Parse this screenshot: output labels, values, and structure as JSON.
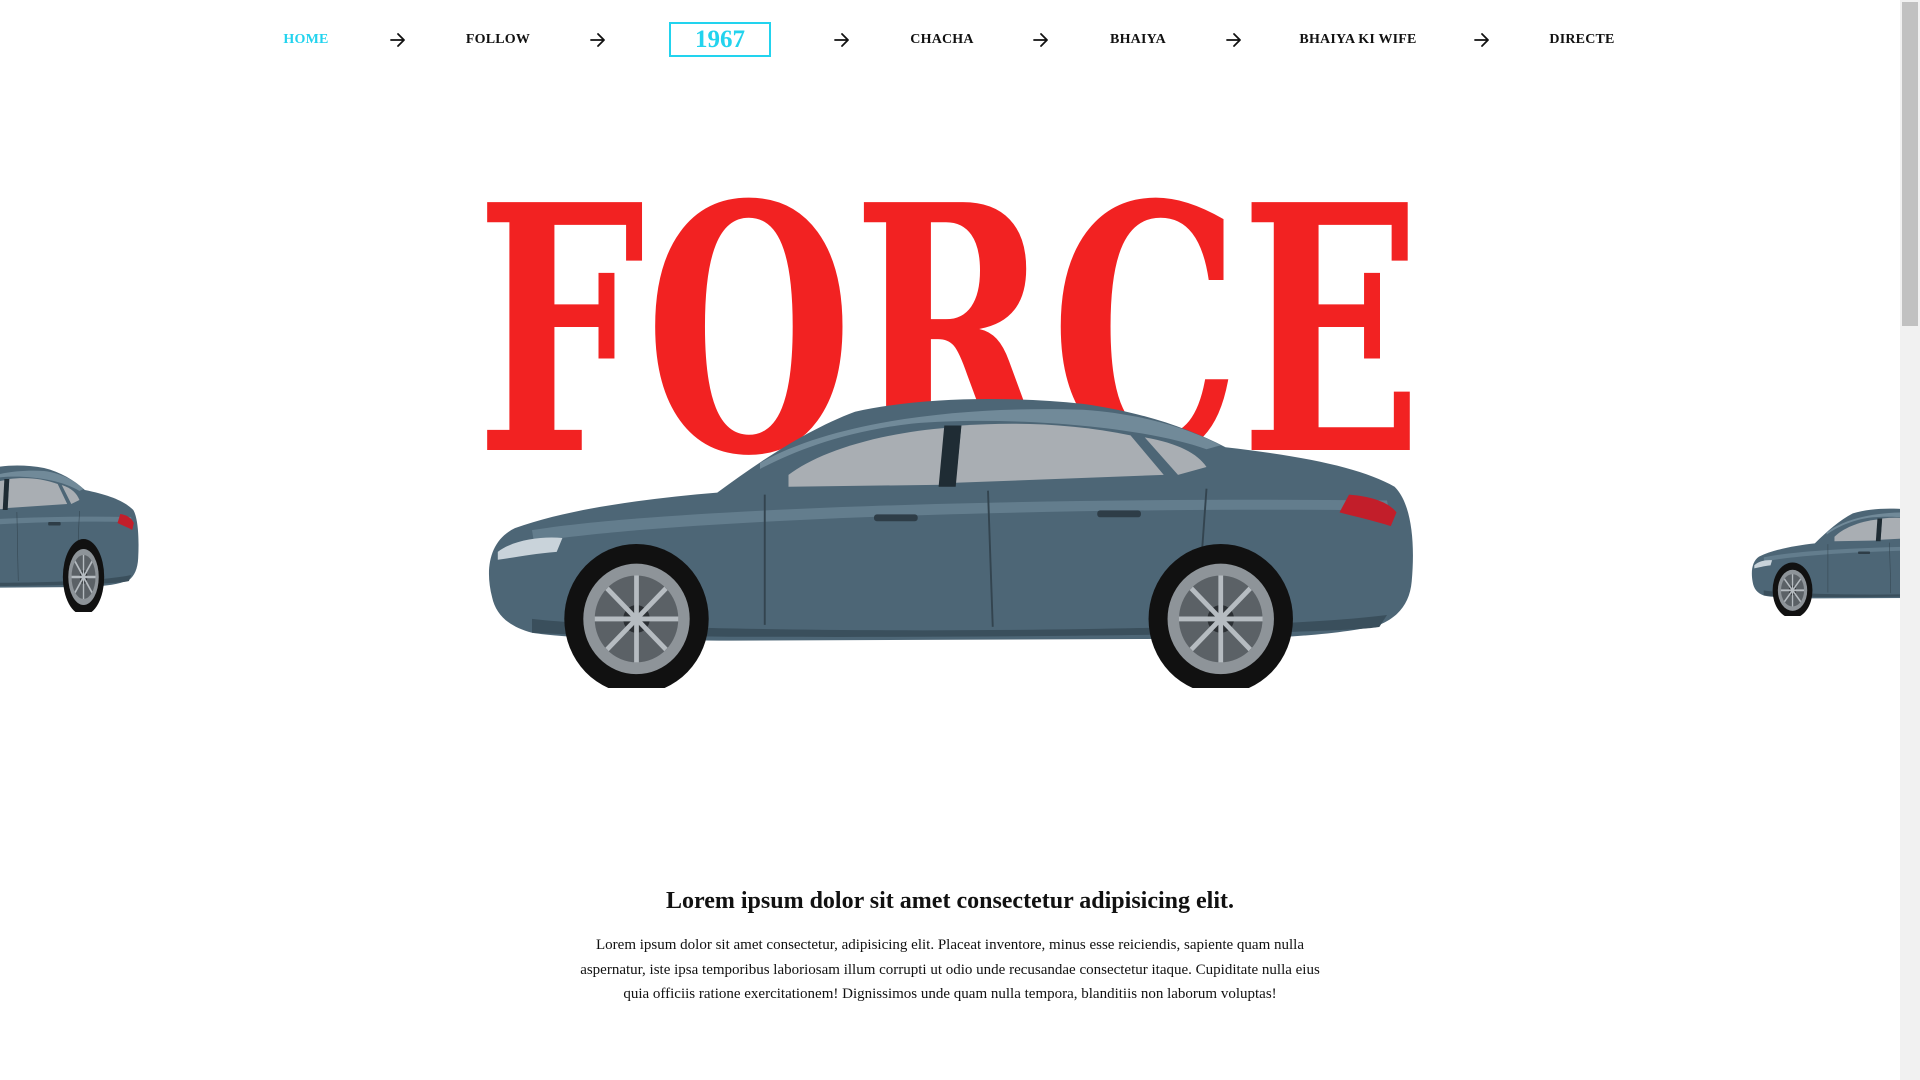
{
  "nav": {
    "items": [
      {
        "label": "HOME",
        "active": true
      },
      {
        "label": "FOLLOW",
        "active": false
      },
      {
        "label": "CHACHA",
        "active": false
      },
      {
        "label": "BHAIYA",
        "active": false
      },
      {
        "label": "BHAIYA KI WIFE",
        "active": false
      },
      {
        "label": "DIRECTE",
        "active": false
      }
    ],
    "logo": "1967",
    "arrow_icon": "arrow-right-icon"
  },
  "hero": {
    "word": "FORCE",
    "word_color": "#f22222",
    "car_color": "#4d6676"
  },
  "content": {
    "heading": "Lorem ipsum dolor sit amet consectetur adipisicing elit.",
    "paragraph": "Lorem ipsum dolor sit amet consectetur, adipisicing elit. Placeat inventore, minus esse reiciendis, sapiente quam nulla aspernatur, iste ipsa temporibus laboriosam illum corrupti ut odio unde recusandae consectetur itaque. Cupiditate nulla eius quia officiis ratione exercitationem! Dignissimos unde quam nulla tempora, blanditiis non laborum voluptas!"
  },
  "colors": {
    "accent": "#22d3ee",
    "text": "#111111",
    "background": "#ffffff"
  }
}
